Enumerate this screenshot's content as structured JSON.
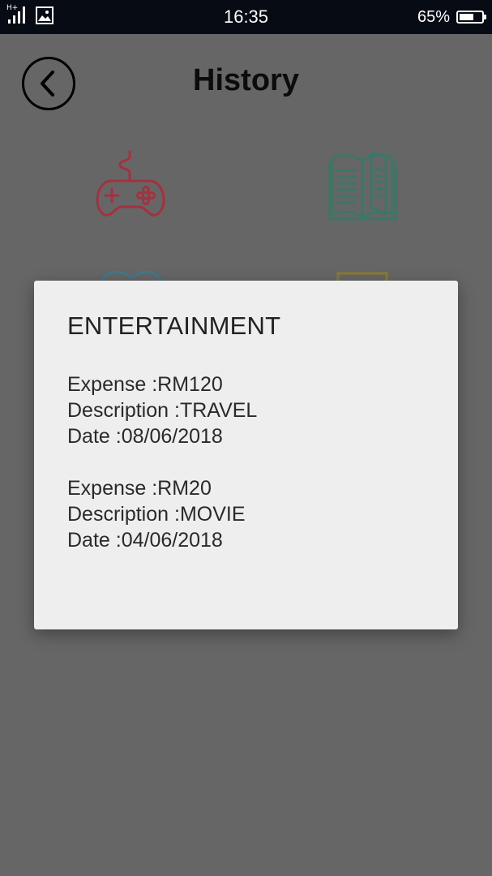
{
  "status_bar": {
    "network": "H+",
    "time": "16:35",
    "battery": "65%",
    "battery_level": 0.65
  },
  "header": {
    "title": "History",
    "back_icon": "back-arrow-icon"
  },
  "categories": [
    {
      "icon": "gamepad-icon",
      "color": "#d0263f"
    },
    {
      "icon": "book-icon",
      "color": "#2f9e7a"
    },
    {
      "icon": "heart-icon",
      "color": "#4aa8d8"
    },
    {
      "icon": "document-icon",
      "color": "#d6c23a"
    }
  ],
  "dialog": {
    "title": "ENTERTAINMENT",
    "entries": [
      {
        "expense": "Expense :RM120",
        "description": "Description :TRAVEL",
        "date": "Date :08/06/2018"
      },
      {
        "expense": "Expense :RM20",
        "description": "Description :MOVIE",
        "date": "Date :04/06/2018"
      }
    ]
  }
}
